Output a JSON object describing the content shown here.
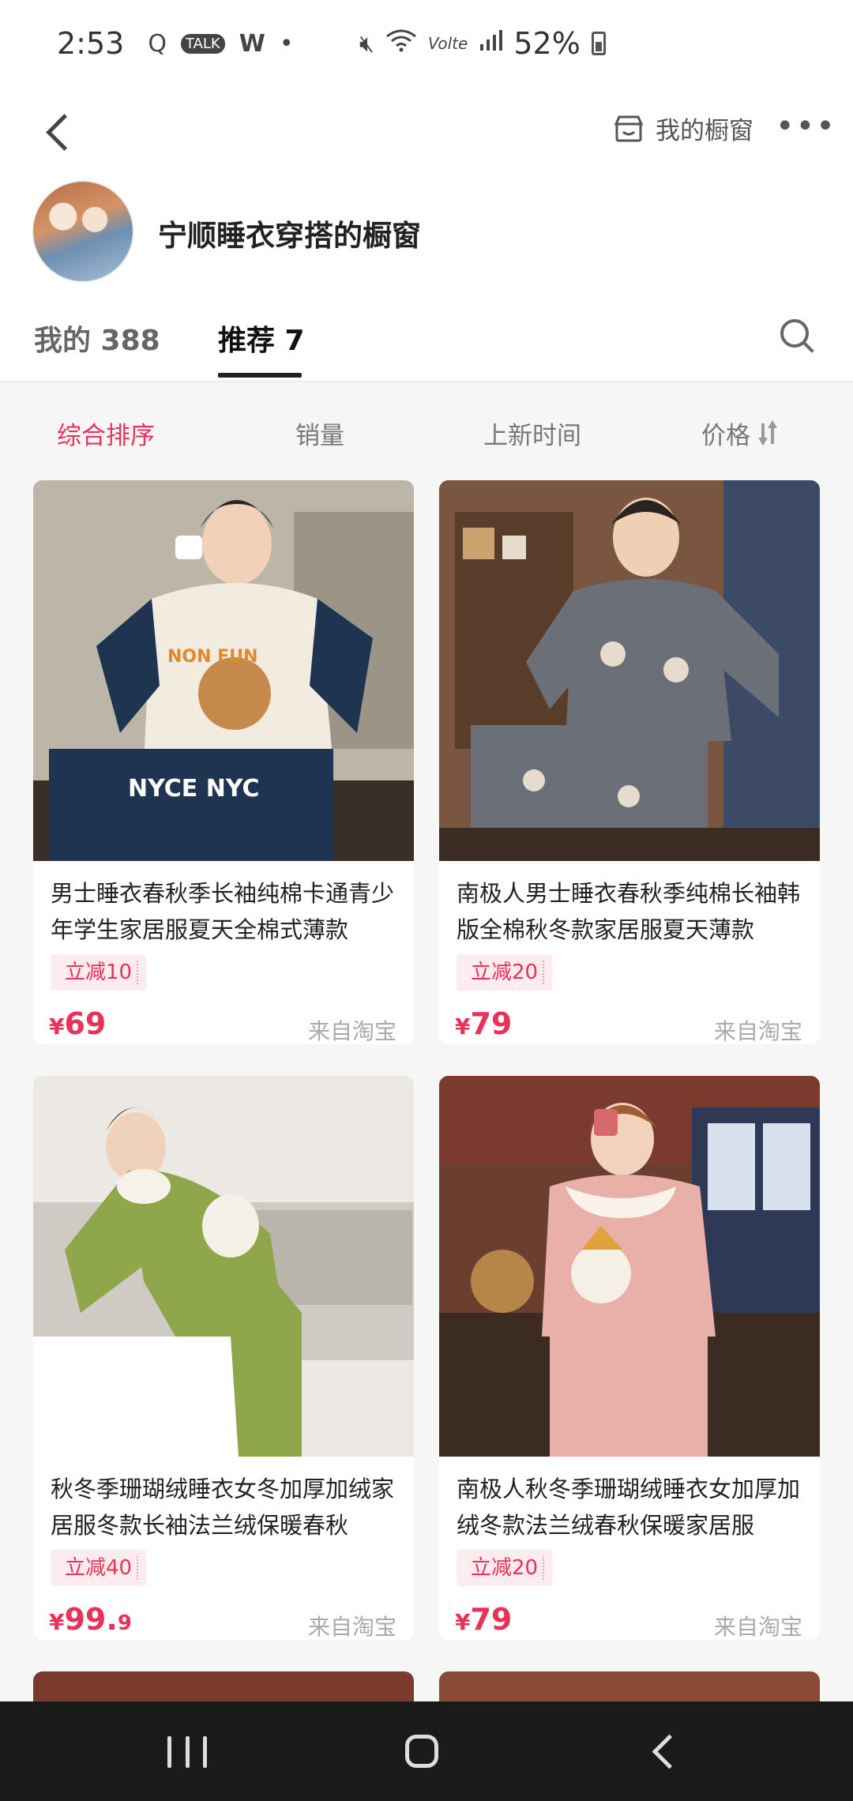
{
  "status_bar": {
    "time": "2:53",
    "icons_left": [
      "Q",
      "TALK",
      "W",
      "•"
    ],
    "battery_pct": "52%",
    "net_label": "Volte"
  },
  "header": {
    "my_window_label": "我的橱窗",
    "more_label": "•••"
  },
  "shop": {
    "title": "宁顺睡衣穿搭的橱窗"
  },
  "tabs": [
    {
      "label": "我的 388"
    },
    {
      "label": "推荐 7"
    }
  ],
  "sort_bar": {
    "comprehensive": "综合排序",
    "sales": "销量",
    "new": "上新时间",
    "price": "价格"
  },
  "products": [
    {
      "title": "男士睡衣春秋季长袖纯棉卡通青少年学生家居服夏天全棉式薄款",
      "discount": "立减10",
      "currency": "¥",
      "price_int": "69",
      "price_dec": "",
      "source": "来自淘宝"
    },
    {
      "title": "南极人男士睡衣春秋季纯棉长袖韩版全棉秋冬款家居服夏天薄款",
      "discount": "立减20",
      "currency": "¥",
      "price_int": "79",
      "price_dec": "",
      "source": "来自淘宝"
    },
    {
      "title": "秋冬季珊瑚绒睡衣女冬加厚加绒家居服冬款长袖法兰绒保暖春秋",
      "discount": "立减40",
      "currency": "¥",
      "price_int": "99.",
      "price_dec": "9",
      "source": "来自淘宝"
    },
    {
      "title": "南极人秋冬季珊瑚绒睡衣女加厚加绒冬款法兰绒春秋保暖家居服",
      "discount": "立减20",
      "currency": "¥",
      "price_int": "79",
      "price_dec": "",
      "source": "来自淘宝"
    }
  ],
  "colors": {
    "accent": "#e8325a",
    "nav_bg": "#1a1a1a"
  }
}
